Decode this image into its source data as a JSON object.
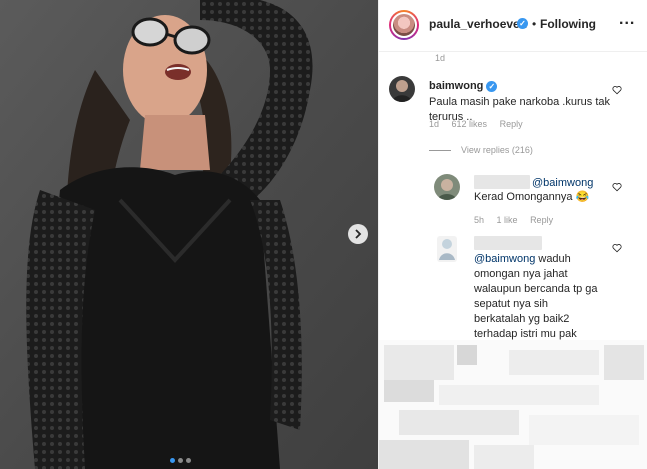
{
  "header": {
    "handle": "paula_verhoeven",
    "separator": "•",
    "following_label": "Following",
    "more_label": "..."
  },
  "top_stub": "1d",
  "comments": [
    {
      "user": "baimwong",
      "verified": true,
      "text": "Paula masih pake narkoba .kurus tak terurus ..",
      "age": "1d",
      "likes": "612 likes",
      "reply_label": "Reply"
    }
  ],
  "view_replies": "View replies (216)",
  "replies": [
    {
      "mention": "@baimwong",
      "text": "Kerad Omongannya 😂",
      "age": "5h",
      "likes": "1 like",
      "reply_label": "Reply"
    },
    {
      "mention": "@baimwong",
      "text_lines": [
        "waduh",
        "omongan nya jahat",
        "walaupun bercanda tp ga",
        "sepatut nya sih",
        "berkatalah yg baik2",
        "terhadap istri mu pak"
      ]
    }
  ],
  "carousel": {
    "dots": 3,
    "active": 0
  },
  "icons": {
    "next": "chevron-right-icon",
    "like": "heart-icon",
    "verified": "verified-badge-icon",
    "more": "more-options-icon"
  },
  "colors": {
    "accent": "#3897f0",
    "text": "#262626",
    "meta": "#999999",
    "border": "#efefef"
  }
}
